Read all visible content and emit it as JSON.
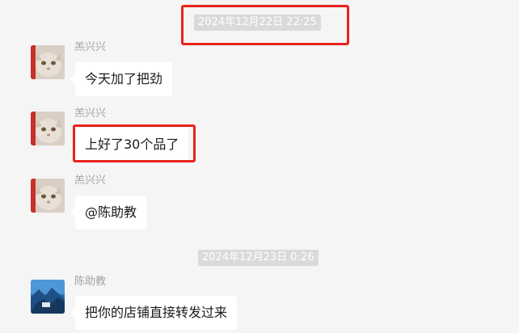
{
  "timestamps": [
    "2024年12月22日 22:25",
    "2024年12月23日 0:26"
  ],
  "messages": [
    {
      "sender": "羔兴兴",
      "text": "今天加了把劲",
      "avatar": "cat-avatar"
    },
    {
      "sender": "羔兴兴",
      "text": "上好了30个品了",
      "avatar": "cat-avatar"
    },
    {
      "sender": "羔兴兴",
      "text": "@陈助教",
      "avatar": "cat-avatar"
    },
    {
      "sender": "陈助教",
      "text": "把你的店铺直接转发过来",
      "avatar": "landscape-avatar"
    }
  ],
  "colors": {
    "highlight": "#e8231c",
    "background": "#f5f5f5",
    "timestamp_bg": "#dadada",
    "bubble": "#ffffff"
  }
}
